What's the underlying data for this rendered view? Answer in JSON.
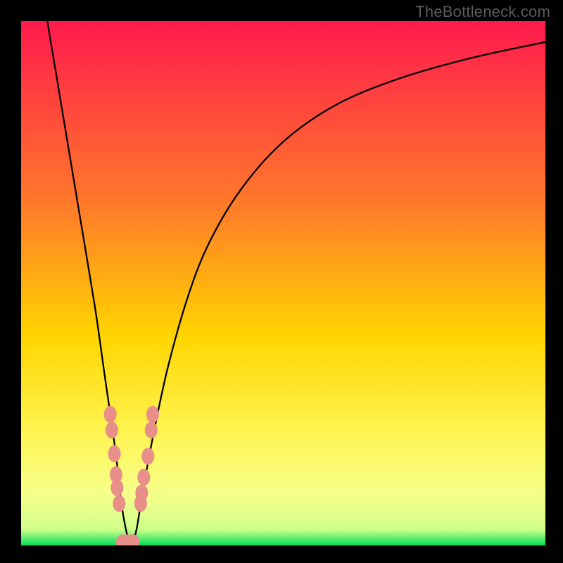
{
  "watermark": "TheBottleneck.com",
  "chart_data": {
    "type": "line",
    "title": "",
    "xlabel": "",
    "ylabel": "",
    "xlim": [
      0,
      100
    ],
    "ylim": [
      0,
      100
    ],
    "grid": false,
    "legend": false,
    "gradient_colors": {
      "top": "#ff1a4d",
      "mid_upper": "#ff7a2a",
      "mid": "#ffd500",
      "mid_lower": "#fff450",
      "low_band": "#f6ff8a",
      "green": "#00e05a"
    },
    "series": [
      {
        "name": "curve",
        "x": [
          5,
          8,
          11,
          14,
          16,
          18,
          19,
          20,
          21,
          22,
          23,
          25,
          28,
          32,
          36,
          42,
          50,
          60,
          72,
          86,
          100
        ],
        "y": [
          100,
          82,
          64,
          46,
          32,
          18,
          9,
          3,
          0,
          3,
          9,
          20,
          34,
          48,
          58,
          68,
          77,
          84,
          89,
          93,
          96
        ]
      }
    ],
    "markers": {
      "name": "data-points",
      "color": "#e98f8a",
      "pts": [
        {
          "x": 17.0,
          "y": 25.0
        },
        {
          "x": 17.3,
          "y": 22.0
        },
        {
          "x": 17.8,
          "y": 17.5
        },
        {
          "x": 18.1,
          "y": 13.5
        },
        {
          "x": 18.3,
          "y": 11.0
        },
        {
          "x": 18.7,
          "y": 8.0
        },
        {
          "x": 19.3,
          "y": 0.5
        },
        {
          "x": 20.0,
          "y": 0.5
        },
        {
          "x": 20.7,
          "y": 0.5
        },
        {
          "x": 21.4,
          "y": 0.5
        },
        {
          "x": 22.8,
          "y": 8.0
        },
        {
          "x": 23.0,
          "y": 10.0
        },
        {
          "x": 23.4,
          "y": 13.0
        },
        {
          "x": 24.2,
          "y": 17.0
        },
        {
          "x": 24.8,
          "y": 22.0
        },
        {
          "x": 25.1,
          "y": 25.0
        }
      ]
    }
  }
}
